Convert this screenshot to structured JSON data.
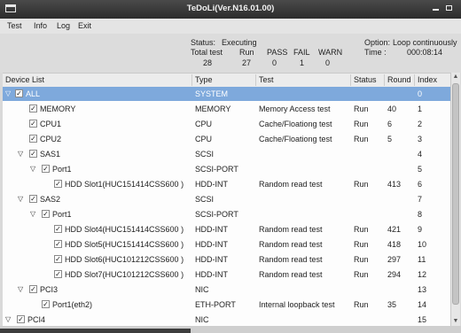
{
  "window": {
    "title": "TeDoLi(Ver.N16.01.00)"
  },
  "menu": [
    "Test",
    "Info",
    "Log",
    "Exit"
  ],
  "status": {
    "status_label": "Status:",
    "status_value": "Executing",
    "total_label": "Total test",
    "total_value": "28",
    "run_label": "Run",
    "run_value": "27",
    "pass_label": "PASS",
    "pass_value": "0",
    "fail_label": "FAIL",
    "fail_value": "1",
    "warn_label": "WARN",
    "warn_value": "0",
    "option_label": "Option:",
    "option_value": "Loop continuously",
    "time_label": "Time :",
    "time_value": "000:08:14"
  },
  "grid": {
    "columns": [
      "Device List",
      "Type",
      "Test",
      "Status",
      "Round",
      "Index"
    ],
    "rows": [
      {
        "expander": "▽",
        "name": "ALL",
        "type": "SYSTEM",
        "test": "",
        "status": "",
        "round": "",
        "index": "0",
        "selected": true
      },
      {
        "expander": "",
        "name": "MEMORY",
        "type": "MEMORY",
        "test": "Memory Access test",
        "status": "Run",
        "round": "40",
        "index": "1"
      },
      {
        "expander": "",
        "name": "CPU1",
        "type": "CPU",
        "test": "Cache/Floationg test",
        "status": "Run",
        "round": "6",
        "index": "2"
      },
      {
        "expander": "",
        "name": "CPU2",
        "type": "CPU",
        "test": "Cache/Floationg test",
        "status": "Run",
        "round": "5",
        "index": "3"
      },
      {
        "expander": "▽",
        "name": "SAS1",
        "type": "SCSI",
        "test": "",
        "status": "",
        "round": "",
        "index": "4"
      },
      {
        "expander": "▽",
        "name": "Port1",
        "type": "SCSI-PORT",
        "test": "",
        "status": "",
        "round": "",
        "index": "5"
      },
      {
        "expander": "",
        "name": "HDD Slot1(HUC151414CSS600 )",
        "type": "HDD-INT",
        "test": "Random read test",
        "status": "Run",
        "round": "413",
        "index": "6"
      },
      {
        "expander": "▽",
        "name": "SAS2",
        "type": "SCSI",
        "test": "",
        "status": "",
        "round": "",
        "index": "7"
      },
      {
        "expander": "▽",
        "name": "Port1",
        "type": "SCSI-PORT",
        "test": "",
        "status": "",
        "round": "",
        "index": "8"
      },
      {
        "expander": "",
        "name": "HDD Slot4(HUC151414CSS600 )",
        "type": "HDD-INT",
        "test": "Random read test",
        "status": "Run",
        "round": "421",
        "index": "9"
      },
      {
        "expander": "",
        "name": "HDD Slot5(HUC151414CSS600 )",
        "type": "HDD-INT",
        "test": "Random read test",
        "status": "Run",
        "round": "418",
        "index": "10"
      },
      {
        "expander": "",
        "name": "HDD Slot6(HUC101212CSS600 )",
        "type": "HDD-INT",
        "test": "Random read test",
        "status": "Run",
        "round": "297",
        "index": "11"
      },
      {
        "expander": "",
        "name": "HDD Slot7(HUC101212CSS600 )",
        "type": "HDD-INT",
        "test": "Random read test",
        "status": "Run",
        "round": "294",
        "index": "12"
      },
      {
        "expander": "▽",
        "name": "PCI3",
        "type": "NIC",
        "test": "",
        "status": "",
        "round": "",
        "index": "13"
      },
      {
        "expander": "",
        "name": "Port1(eth2)",
        "type": "ETH-PORT",
        "test": "Internal loopback test",
        "status": "Run",
        "round": "35",
        "index": "14"
      },
      {
        "expander": "▽",
        "name": "PCI4",
        "type": "NIC",
        "test": "",
        "status": "",
        "round": "",
        "index": "15"
      }
    ]
  },
  "checkbox_glyph": "✓",
  "colors": {
    "selection": "#7ea9dc",
    "titlebar": "#2c2c2c"
  }
}
